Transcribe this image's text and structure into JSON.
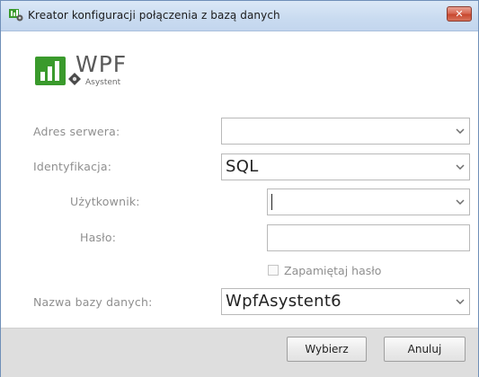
{
  "window": {
    "title": "Kreator konfiguracji połączenia z bazą danych",
    "close_glyph": "✕",
    "accent_color": "#c8482f"
  },
  "logo": {
    "title": "WPF",
    "subtitle": "Asystent"
  },
  "form": {
    "server_label": "Adres serwera:",
    "server_value": "",
    "auth_label": "Identyfikacja:",
    "auth_value": "SQL",
    "user_label": "Użytkownik:",
    "user_value": "",
    "password_label": "Hasło:",
    "password_value": "",
    "remember_label": "Zapamiętaj hasło",
    "remember_checked": false,
    "db_label": "Nazwa bazy danych:",
    "db_value": "WpfAsystent6"
  },
  "buttons": {
    "select_label": "Wybierz",
    "cancel_label": "Anuluj"
  },
  "icons": {
    "dropdown": "chevron-down-icon"
  }
}
